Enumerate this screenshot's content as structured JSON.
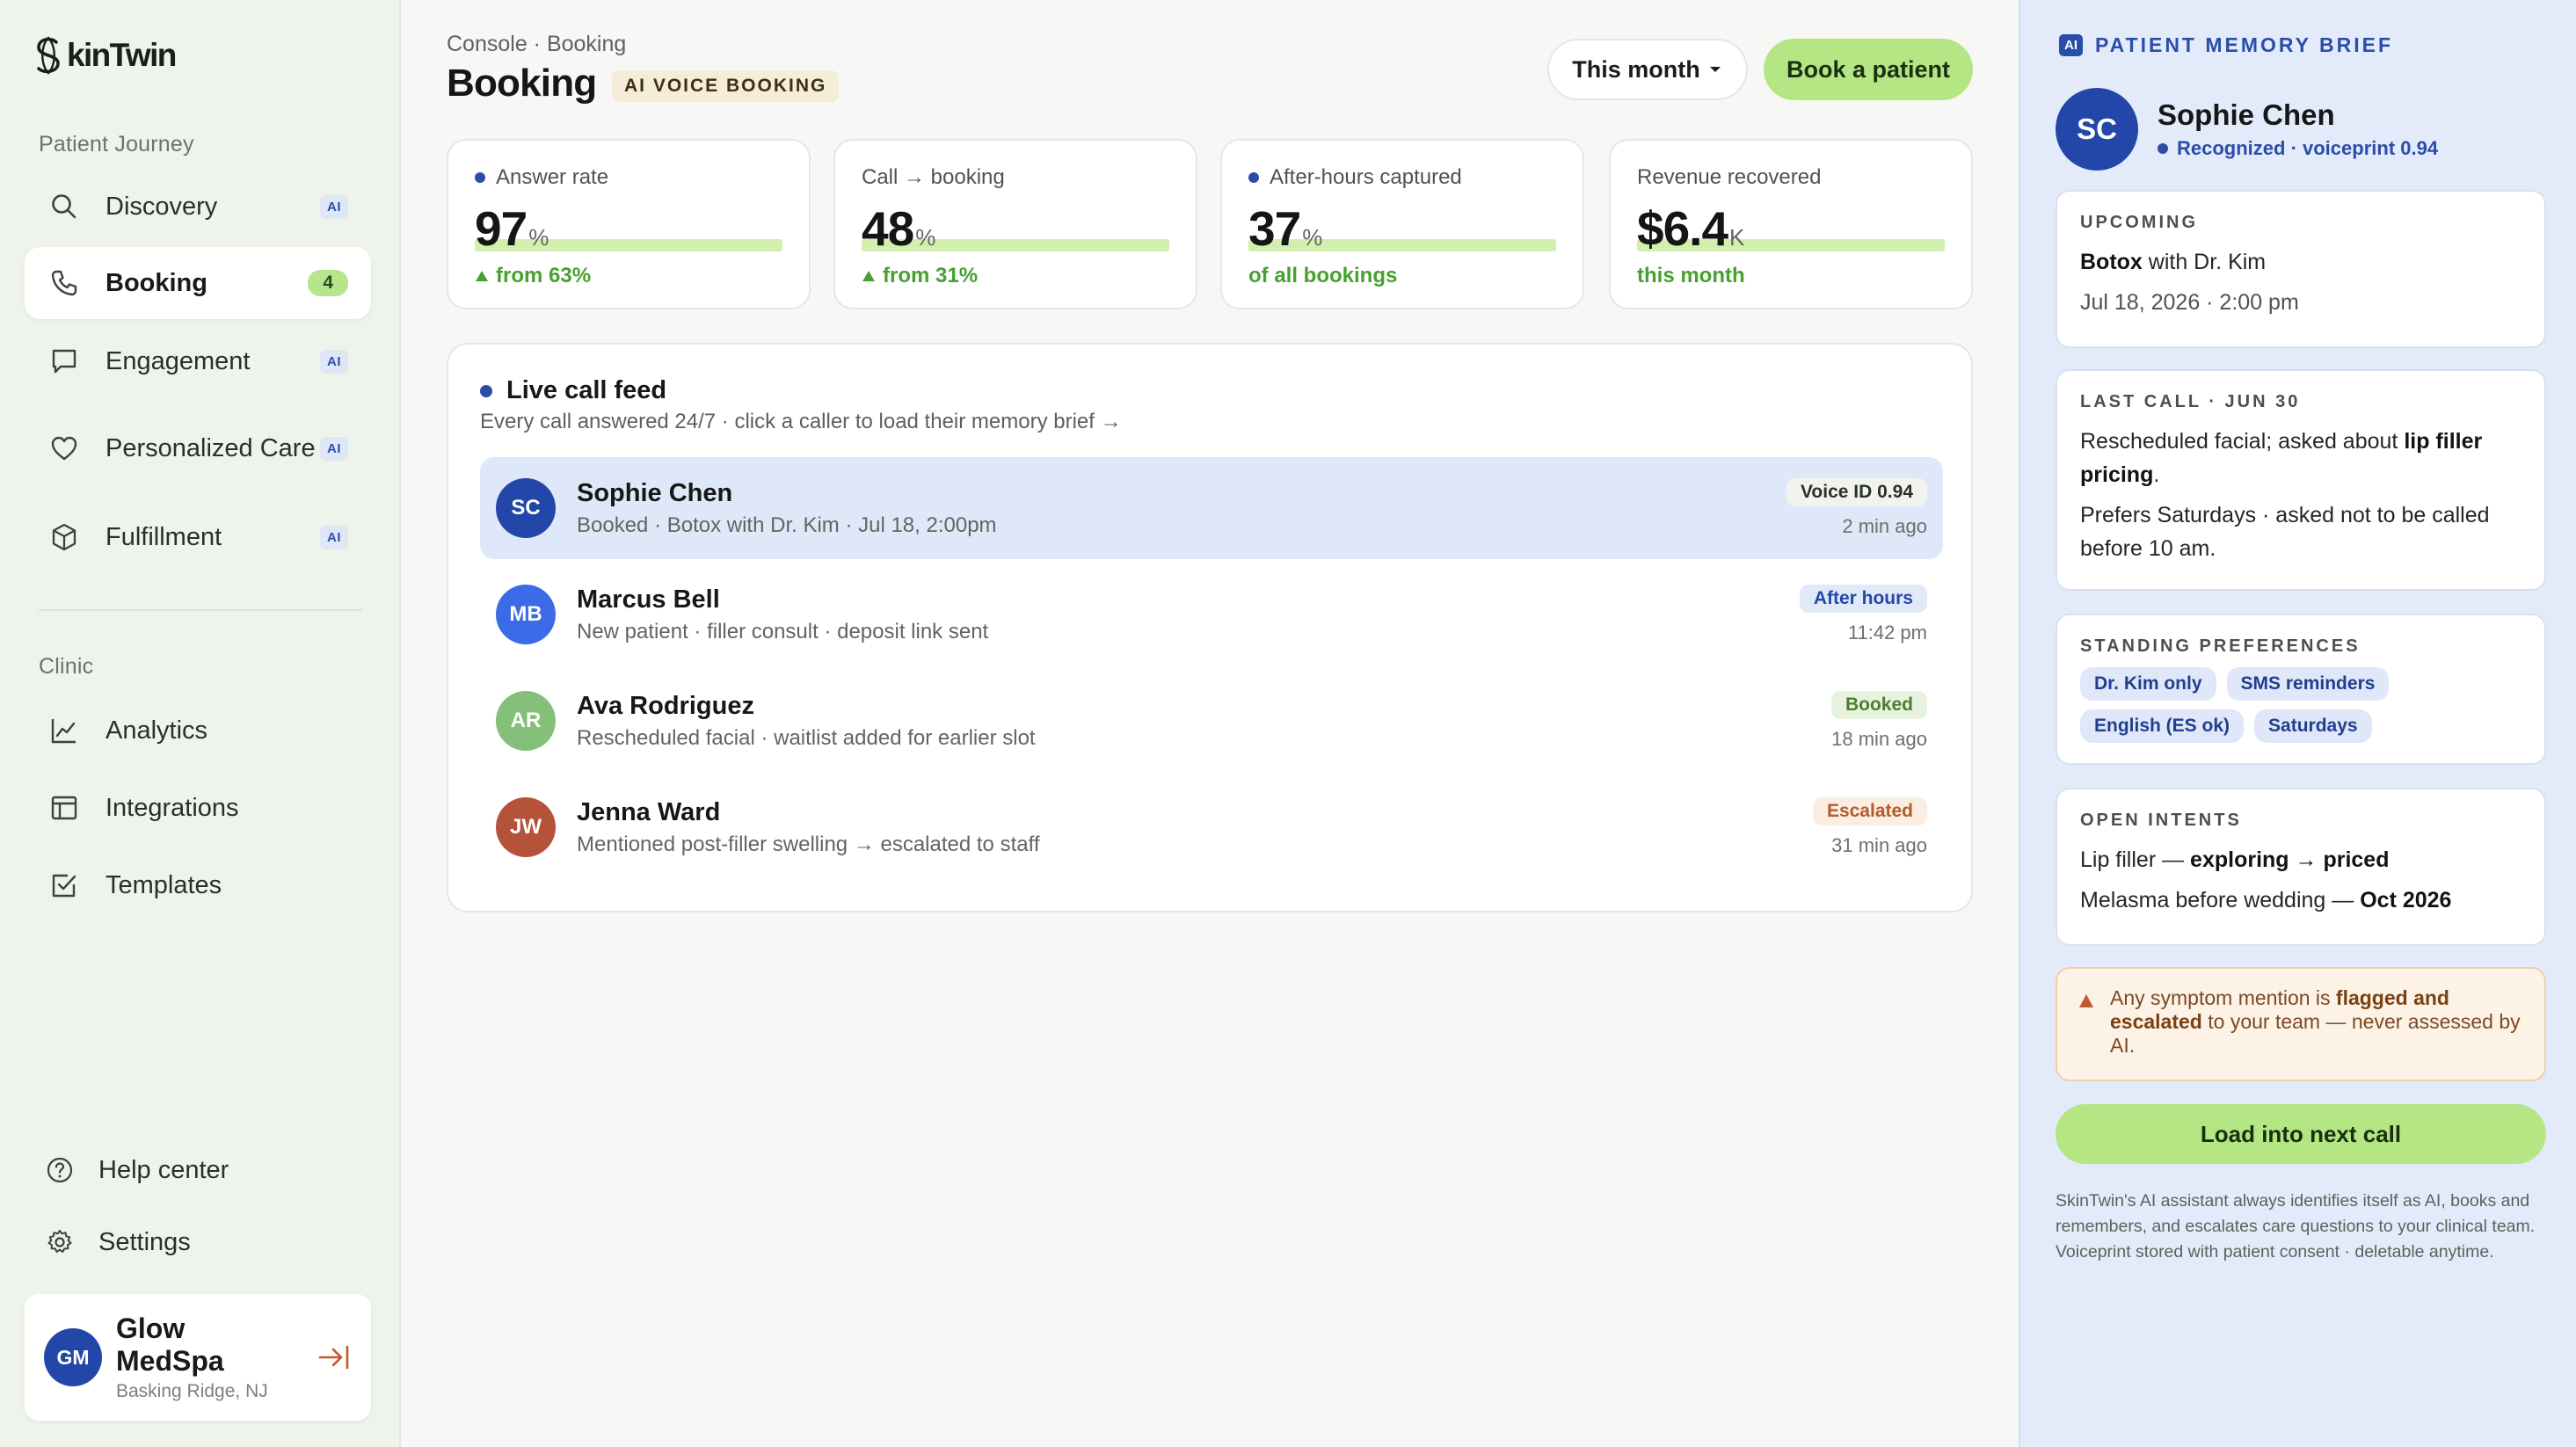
{
  "brand": {
    "name": "kinTwin"
  },
  "sidebar": {
    "section_journey": "Patient Journey",
    "journey_items": [
      {
        "label": "Discovery",
        "badge": "AI",
        "icon": "search-icon"
      },
      {
        "label": "Booking",
        "count": "4",
        "icon": "phone-icon"
      },
      {
        "label": "Engagement",
        "badge": "AI",
        "icon": "chat-bubble-icon"
      },
      {
        "label": "Personalized Care",
        "badge": "AI",
        "icon": "heart-icon"
      },
      {
        "label": "Fulfillment",
        "badge": "AI",
        "icon": "box-icon"
      }
    ],
    "section_clinic": "Clinic",
    "clinic_items": [
      {
        "label": "Analytics",
        "icon": "line-chart-icon"
      },
      {
        "label": "Integrations",
        "icon": "table-icon"
      },
      {
        "label": "Templates",
        "icon": "checkbox-icon"
      }
    ],
    "footer_items": [
      {
        "label": "Help center",
        "icon": "help-circle-icon"
      },
      {
        "label": "Settings",
        "icon": "gear-icon"
      }
    ],
    "clinic_card": {
      "initials": "GM",
      "name": "Glow MedSpa",
      "location": "Basking Ridge, NJ"
    }
  },
  "header": {
    "breadcrumb": "Console · Booking",
    "title": "Booking",
    "tag": "AI VOICE BOOKING",
    "period_select": "This month",
    "primary_action": "Book a patient"
  },
  "kpis": [
    {
      "label": "Answer rate",
      "value": "97",
      "unit": "%",
      "delta": "from 63%",
      "has_dot": true,
      "has_arrow": true,
      "fill": 1.0
    },
    {
      "label": "Call → booking",
      "value": "48",
      "unit": "%",
      "delta": "from 31%",
      "has_dot": false,
      "has_arrow": true,
      "fill": 1.0
    },
    {
      "label": "After-hours captured",
      "value": "37",
      "unit": "%",
      "delta": "of all bookings",
      "has_dot": true,
      "has_arrow": false,
      "fill": 1.0
    },
    {
      "label": "Revenue recovered",
      "value": "$6.4",
      "unit": "K",
      "delta": "this month",
      "has_dot": false,
      "has_arrow": false,
      "fill": 1.0
    }
  ],
  "feed": {
    "title": "Live call feed",
    "subtitle": "Every call answered 24/7 · click a caller to load their memory brief →",
    "calls": [
      {
        "initials": "SC",
        "name": "Sophie Chen",
        "detail": "Booked · Botox with Dr. Kim · Jul 18, 2:00pm",
        "badge": "Voice ID 0.94",
        "time": "2 min ago",
        "avatar_color": "#2347a8",
        "badge_bg": "#f1f3ee",
        "badge_fg": "#2b302b"
      },
      {
        "initials": "MB",
        "name": "Marcus Bell",
        "detail": "New patient · filler consult · deposit link sent",
        "badge": "After hours",
        "time": "11:42 pm",
        "avatar_color": "#3d6ae6",
        "badge_bg": "#e1e9f9",
        "badge_fg": "#2448a8"
      },
      {
        "initials": "AR",
        "name": "Ava Rodriguez",
        "detail": "Rescheduled facial · waitlist added for earlier slot",
        "badge": "Booked",
        "time": "18 min ago",
        "avatar_color": "#84c07a",
        "badge_bg": "#e7f3dc",
        "badge_fg": "#4d7d33"
      },
      {
        "initials": "JW",
        "name": "Jenna Ward",
        "detail": "Mentioned post-filler swelling → escalated to staff",
        "badge": "Escalated",
        "time": "31 min ago",
        "avatar_color": "#b5523a",
        "badge_bg": "#faeee2",
        "badge_fg": "#b65a2a"
      }
    ]
  },
  "brief": {
    "ai_tag": "AI",
    "title": "PATIENT MEMORY BRIEF",
    "patient": {
      "initials": "SC",
      "name": "Sophie Chen",
      "status": "Recognized · voiceprint 0.94"
    },
    "upcoming": {
      "label": "UPCOMING",
      "service": "Botox",
      "with": " with Dr. Kim",
      "when": "Jul 18, 2026 · 2:00 pm"
    },
    "last_call": {
      "label": "LAST CALL · JUN 30",
      "text_pre": "Rescheduled facial; asked about ",
      "text_bold": "lip filler pricing",
      "text_post": ".",
      "note": "Prefers Saturdays · asked not to be called before 10 am."
    },
    "preferences": {
      "label": "STANDING PREFERENCES",
      "chips": [
        "Dr. Kim only",
        "SMS reminders",
        "English (ES ok)",
        "Saturdays"
      ]
    },
    "intents": {
      "label": "OPEN INTENTS",
      "items": [
        {
          "pre": "Lip filler — ",
          "bold": "exploring → priced"
        },
        {
          "pre": "Melasma before wedding — ",
          "bold": "Oct 2026"
        }
      ]
    },
    "warning": {
      "pre": "Any symptom mention is ",
      "bold": "flagged and escalated",
      "post": " to your team — never assessed by AI."
    },
    "action": "Load into next call",
    "disclaimer": "SkinTwin's AI assistant always identifies itself as AI, books and remembers, and escalates care questions to your clinical team. Voiceprint stored with patient consent · deletable anytime."
  }
}
